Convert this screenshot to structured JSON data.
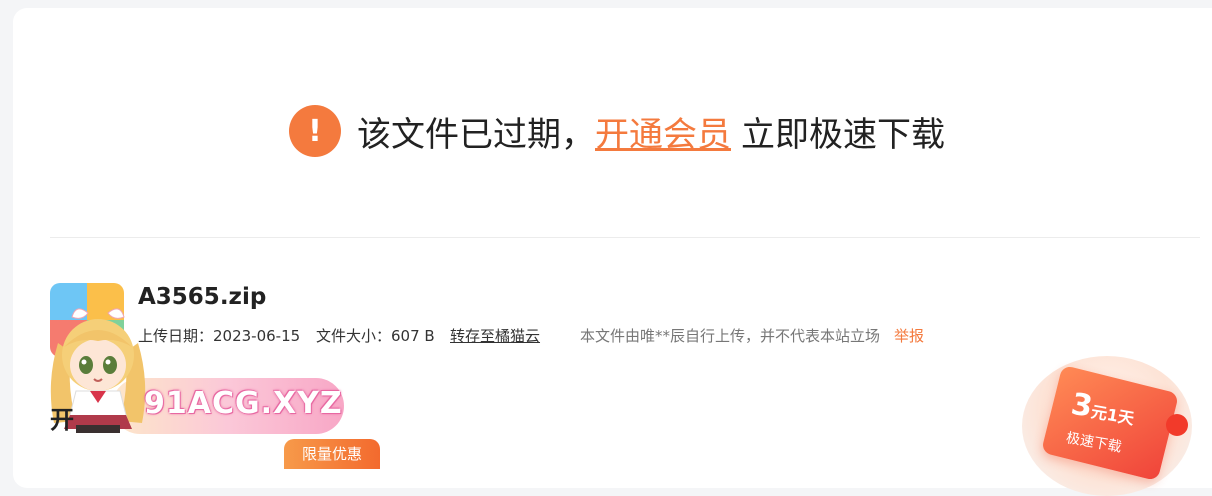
{
  "notice": {
    "icon": "exclamation-icon",
    "text": "该文件已过期，",
    "member_link": "开通会员",
    "tail": "立即极速下载"
  },
  "file": {
    "name": "A3565.zip",
    "upload_date_label": "上传日期：2023-06-15",
    "size_label": "文件大小：607 B",
    "save_link": "转存至橘猫云",
    "disclaimer": "本文件由唯**辰自行上传，并不代表本站立场",
    "report": "举报"
  },
  "overlay": {
    "watermark": "91ACG.XYZ",
    "peek_char": "开",
    "limited_label": "限量优惠"
  },
  "promo": {
    "price": "3",
    "unit": "元1天",
    "subtitle": "极速下载"
  },
  "colors": {
    "accent": "#f47a3e",
    "text": "#222222",
    "muted": "#777777"
  }
}
